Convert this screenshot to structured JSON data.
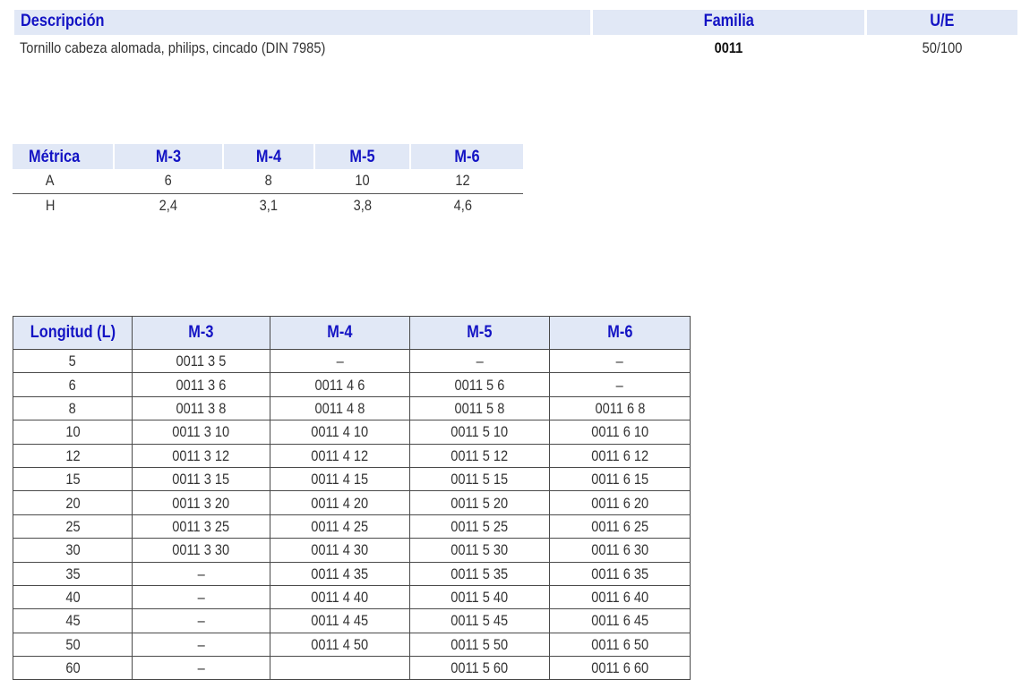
{
  "description": {
    "headers": {
      "descripcion": "Descripción",
      "familia": "Familia",
      "ue": "U/E"
    },
    "values": {
      "descripcion": "Tornillo cabeza alomada, philips, cincado (DIN 7985)",
      "familia": "0011",
      "ue": "50/100"
    }
  },
  "metrics": {
    "headers": [
      "Métrica",
      "M-3",
      "M-4",
      "M-5",
      "M-6"
    ],
    "rows": [
      [
        "A",
        "6",
        "8",
        "10",
        "12"
      ],
      [
        "H",
        "2,4",
        "3,1",
        "3,8",
        "4,6"
      ]
    ]
  },
  "lengths": {
    "headers": [
      "Longitud (L)",
      "M-3",
      "M-4",
      "M-5",
      "M-6"
    ],
    "rows": [
      [
        "5",
        "0011 3 5",
        "–",
        "–",
        "–"
      ],
      [
        "6",
        "0011 3 6",
        "0011 4 6",
        "0011 5 6",
        "–"
      ],
      [
        "8",
        "0011 3 8",
        "0011 4 8",
        "0011 5 8",
        "0011 6 8"
      ],
      [
        "10",
        "0011 3 10",
        "0011 4 10",
        "0011 5 10",
        "0011 6 10"
      ],
      [
        "12",
        "0011 3 12",
        "0011 4 12",
        "0011 5 12",
        "0011 6 12"
      ],
      [
        "15",
        "0011 3 15",
        "0011 4 15",
        "0011 5 15",
        "0011 6 15"
      ],
      [
        "20",
        "0011 3 20",
        "0011 4 20",
        "0011 5 20",
        "0011 6 20"
      ],
      [
        "25",
        "0011 3 25",
        "0011 4 25",
        "0011 5 25",
        "0011 6 25"
      ],
      [
        "30",
        "0011 3 30",
        "0011 4 30",
        "0011 5 30",
        "0011 6 30"
      ],
      [
        "35",
        "–",
        "0011 4 35",
        "0011 5 35",
        "0011 6 35"
      ],
      [
        "40",
        "–",
        "0011 4 40",
        "0011 5 40",
        "0011 6 40"
      ],
      [
        "45",
        "–",
        "0011 4 45",
        "0011 5 45",
        "0011 6 45"
      ],
      [
        "50",
        "–",
        "0011 4 50",
        "0011 5 50",
        "0011 6 50"
      ],
      [
        "60",
        "–",
        "",
        "0011 5 60",
        "0011 6 60"
      ]
    ]
  },
  "colors": {
    "header_bg": "#e1e8f6",
    "header_text": "#1313c4",
    "body_text": "#333333",
    "border": "#4a4a4a"
  }
}
